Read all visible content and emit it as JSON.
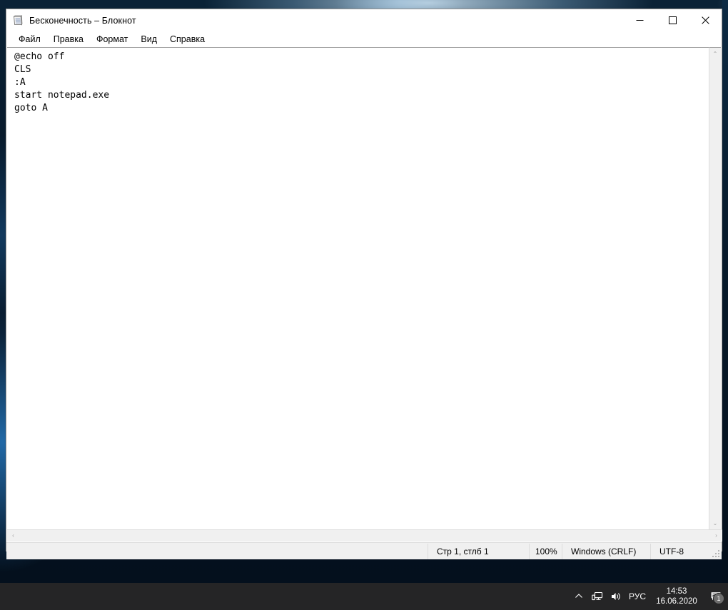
{
  "window": {
    "title": "Бесконечность – Блокнот",
    "app_icon": "notepad-icon",
    "controls": {
      "minimize": "—",
      "maximize": "□",
      "close": "✕"
    }
  },
  "menu": {
    "items": [
      {
        "label": "Файл"
      },
      {
        "label": "Правка"
      },
      {
        "label": "Формат"
      },
      {
        "label": "Вид"
      },
      {
        "label": "Справка"
      }
    ]
  },
  "editor": {
    "content": "@echo off\nCLS\n:A\nstart notepad.exe\ngoto A",
    "lines": [
      "@echo off",
      "CLS",
      ":A",
      "start notepad.exe",
      "goto A"
    ]
  },
  "scrollbars": {
    "vertical_up": "⌃",
    "vertical_down": "⌄",
    "horizontal_left": "‹",
    "horizontal_right": "›"
  },
  "status_bar": {
    "position": "Стр 1, стлб 1",
    "zoom": "100%",
    "line_ending": "Windows (CRLF)",
    "encoding": "UTF-8"
  },
  "taskbar": {
    "language": "РУС",
    "time": "14:53",
    "date": "16.06.2020",
    "notification_count": "1",
    "chevron": "⌃"
  },
  "colors": {
    "taskbar_bg": "#252526",
    "window_bg": "#ffffff",
    "chrome_bg": "#f0f0f0",
    "desktop_dark": "#07192a",
    "desktop_accent": "#2678be",
    "text": "#000000"
  }
}
